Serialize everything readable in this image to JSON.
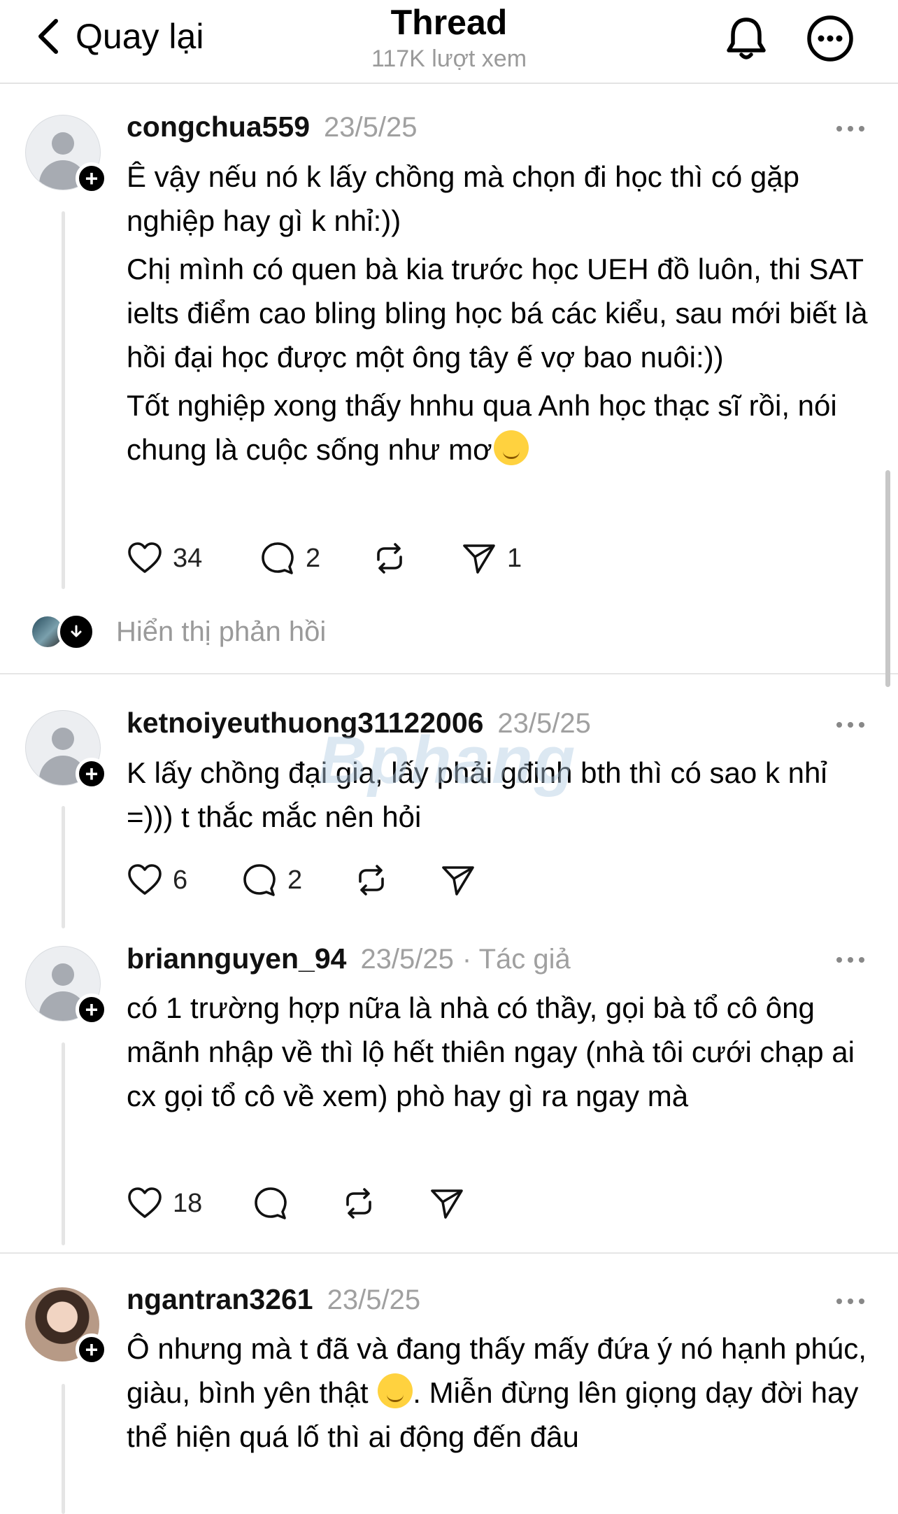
{
  "header": {
    "back_label": "Quay lại",
    "title": "Thread",
    "views": "117K lượt xem",
    "icons": [
      "chevron-left-icon",
      "bell-icon",
      "more-circle-icon"
    ]
  },
  "posts": [
    {
      "username": "congchua559",
      "date": "23/5/25",
      "paragraphs": [
        "Ê vậy nếu nó k lấy chồng mà chọn đi học thì có gặp nghiệp hay gì k nhỉ:))",
        "Chị mình có quen bà kia trước học UEH đồ luôn, thi SAT ielts điểm cao bling bling học bá các kiểu, sau mới biết là hồi đại học được một ông tây ế vợ bao nuôi:))",
        "Tốt nghiệp xong thấy hnhu qua Anh học thạc sĩ rồi, nói chung là cuộc sống như mơ"
      ],
      "emoji": "relieved-face-emoji",
      "likes": "34",
      "replies": "2",
      "reposts": "",
      "shares": "1"
    },
    {
      "username": "ketnoiyeuthuong31122006",
      "date": "23/5/25",
      "text": "K lấy chồng đại gia, lấy phải gđinh bth thì có sao k nhỉ =))) t thắc mắc nên hỏi",
      "likes": "6",
      "replies": "2",
      "reposts": "",
      "shares": ""
    },
    {
      "username": "briannguyen_94",
      "date": "23/5/25",
      "tag": "· Tác giả",
      "text": "có 1 trường hợp nữa là nhà có thầy, gọi bà tổ cô ông mãnh nhập về thì lộ hết thiên ngay (nhà tôi cưới chạp ai cx gọi tổ cô về xem) phò hay gì ra ngay mà",
      "likes": "18",
      "replies": "",
      "reposts": "",
      "shares": ""
    },
    {
      "username": "ngantran3261",
      "date": "23/5/25",
      "text_before_emoji": "Ô nhưng mà t đã và đang thấy mấy đứa ý nó hạnh phúc, giàu,  bình yên thật ",
      "emoji": "grinning-sweat-emoji",
      "text_after_emoji": ". Miễn đừng lên giọng dạy đời hay thể hiện quá lố thì ai động đến đâu"
    }
  ],
  "show_replies_label": "Hiển thị phản hồi",
  "watermark": "Bphang",
  "colors": {
    "muted": "#a0a0a0",
    "divider": "#e6e6e6",
    "text": "#000000"
  }
}
